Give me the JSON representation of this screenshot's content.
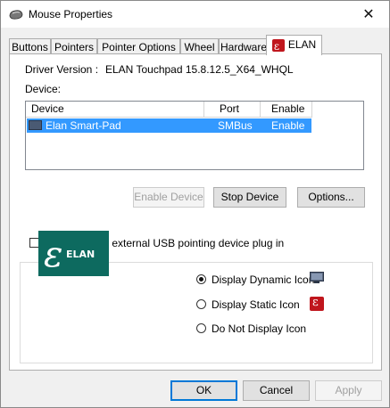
{
  "window": {
    "title": "Mouse Properties",
    "close_symbol": "✕"
  },
  "tabs": [
    {
      "label": "Buttons"
    },
    {
      "label": "Pointers"
    },
    {
      "label": "Pointer Options"
    },
    {
      "label": "Wheel"
    },
    {
      "label": "Hardware"
    },
    {
      "label": "ELAN",
      "icon": "elan-icon"
    }
  ],
  "driver": {
    "label": "Driver Version :",
    "value": "ELAN Touchpad 15.8.12.5_X64_WHQL"
  },
  "device_label": "Device:",
  "device_list": {
    "columns": [
      "Device",
      "Port",
      "Enable"
    ],
    "rows": [
      {
        "device": "Elan Smart-Pad",
        "port": "SMBus",
        "enable": "Enable",
        "selected": true
      }
    ]
  },
  "buttons": {
    "enable_device": "Enable Device",
    "stop_device": "Stop Device",
    "options": "Options...",
    "ok": "OK",
    "cancel": "Cancel",
    "apply": "Apply"
  },
  "disable_checkbox": {
    "label": "Disable when external USB pointing device plug in",
    "checked": false
  },
  "icon_options": [
    {
      "label": "Display Dynamic Icon",
      "checked": true,
      "icon": "monitor-icon"
    },
    {
      "label": "Display Static Icon",
      "checked": false,
      "icon": "elan-icon"
    },
    {
      "label": "Do Not Display Icon",
      "checked": false
    }
  ],
  "logo": {
    "text": "ELAN",
    "bg_color": "#0d6a5f"
  },
  "colors": {
    "selection": "#3399ff",
    "accent": "#0078d7",
    "elan_red": "#c0161d"
  }
}
